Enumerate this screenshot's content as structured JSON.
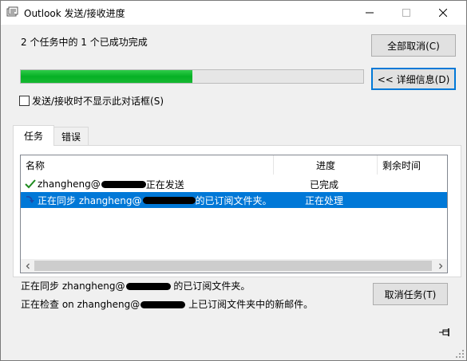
{
  "window": {
    "title": "Outlook 发送/接收进度",
    "icons": {
      "app": "outlook-send-receive-icon",
      "minimize": "minimize-icon",
      "maximize": "maximize-icon",
      "close": "close-icon"
    }
  },
  "status": {
    "summary": "2 个任务中的 1 个已成功完成",
    "progress_fraction": 0.5
  },
  "buttons": {
    "cancel_all": "全部取消(C)",
    "details": "<< 详细信息(D)",
    "cancel_task": "取消任务(T)"
  },
  "checkbox": {
    "label": "发送/接收时不显示此对话框(S)",
    "checked": false
  },
  "tabs": [
    {
      "label": "任务",
      "active": true
    },
    {
      "label": "错误",
      "active": false
    }
  ],
  "list": {
    "columns": [
      "名称",
      "进度",
      "剩余时间"
    ],
    "rows": [
      {
        "icon": "checkmark-icon",
        "name_prefix": "zhangheng@",
        "name_suffix": " 正在发送",
        "progress": "已完成",
        "remaining": "",
        "selected": false
      },
      {
        "icon": "sync-arrow-icon",
        "name_prefix": "正在同步 zhangheng@",
        "name_suffix": " 的已订阅文件夹。",
        "progress": "正在处理",
        "remaining": "",
        "selected": true
      }
    ]
  },
  "details": {
    "line1_prefix": "正在同步 zhangheng@",
    "line1_suffix": " 的已订阅文件夹。",
    "line2_prefix": "正在检查 on zhangheng@",
    "line2_suffix": " 上已订阅文件夹中的新邮件。"
  },
  "colors": {
    "selection": "#0078d7",
    "progress": "#06b025",
    "focus_border": "#0078d7"
  }
}
